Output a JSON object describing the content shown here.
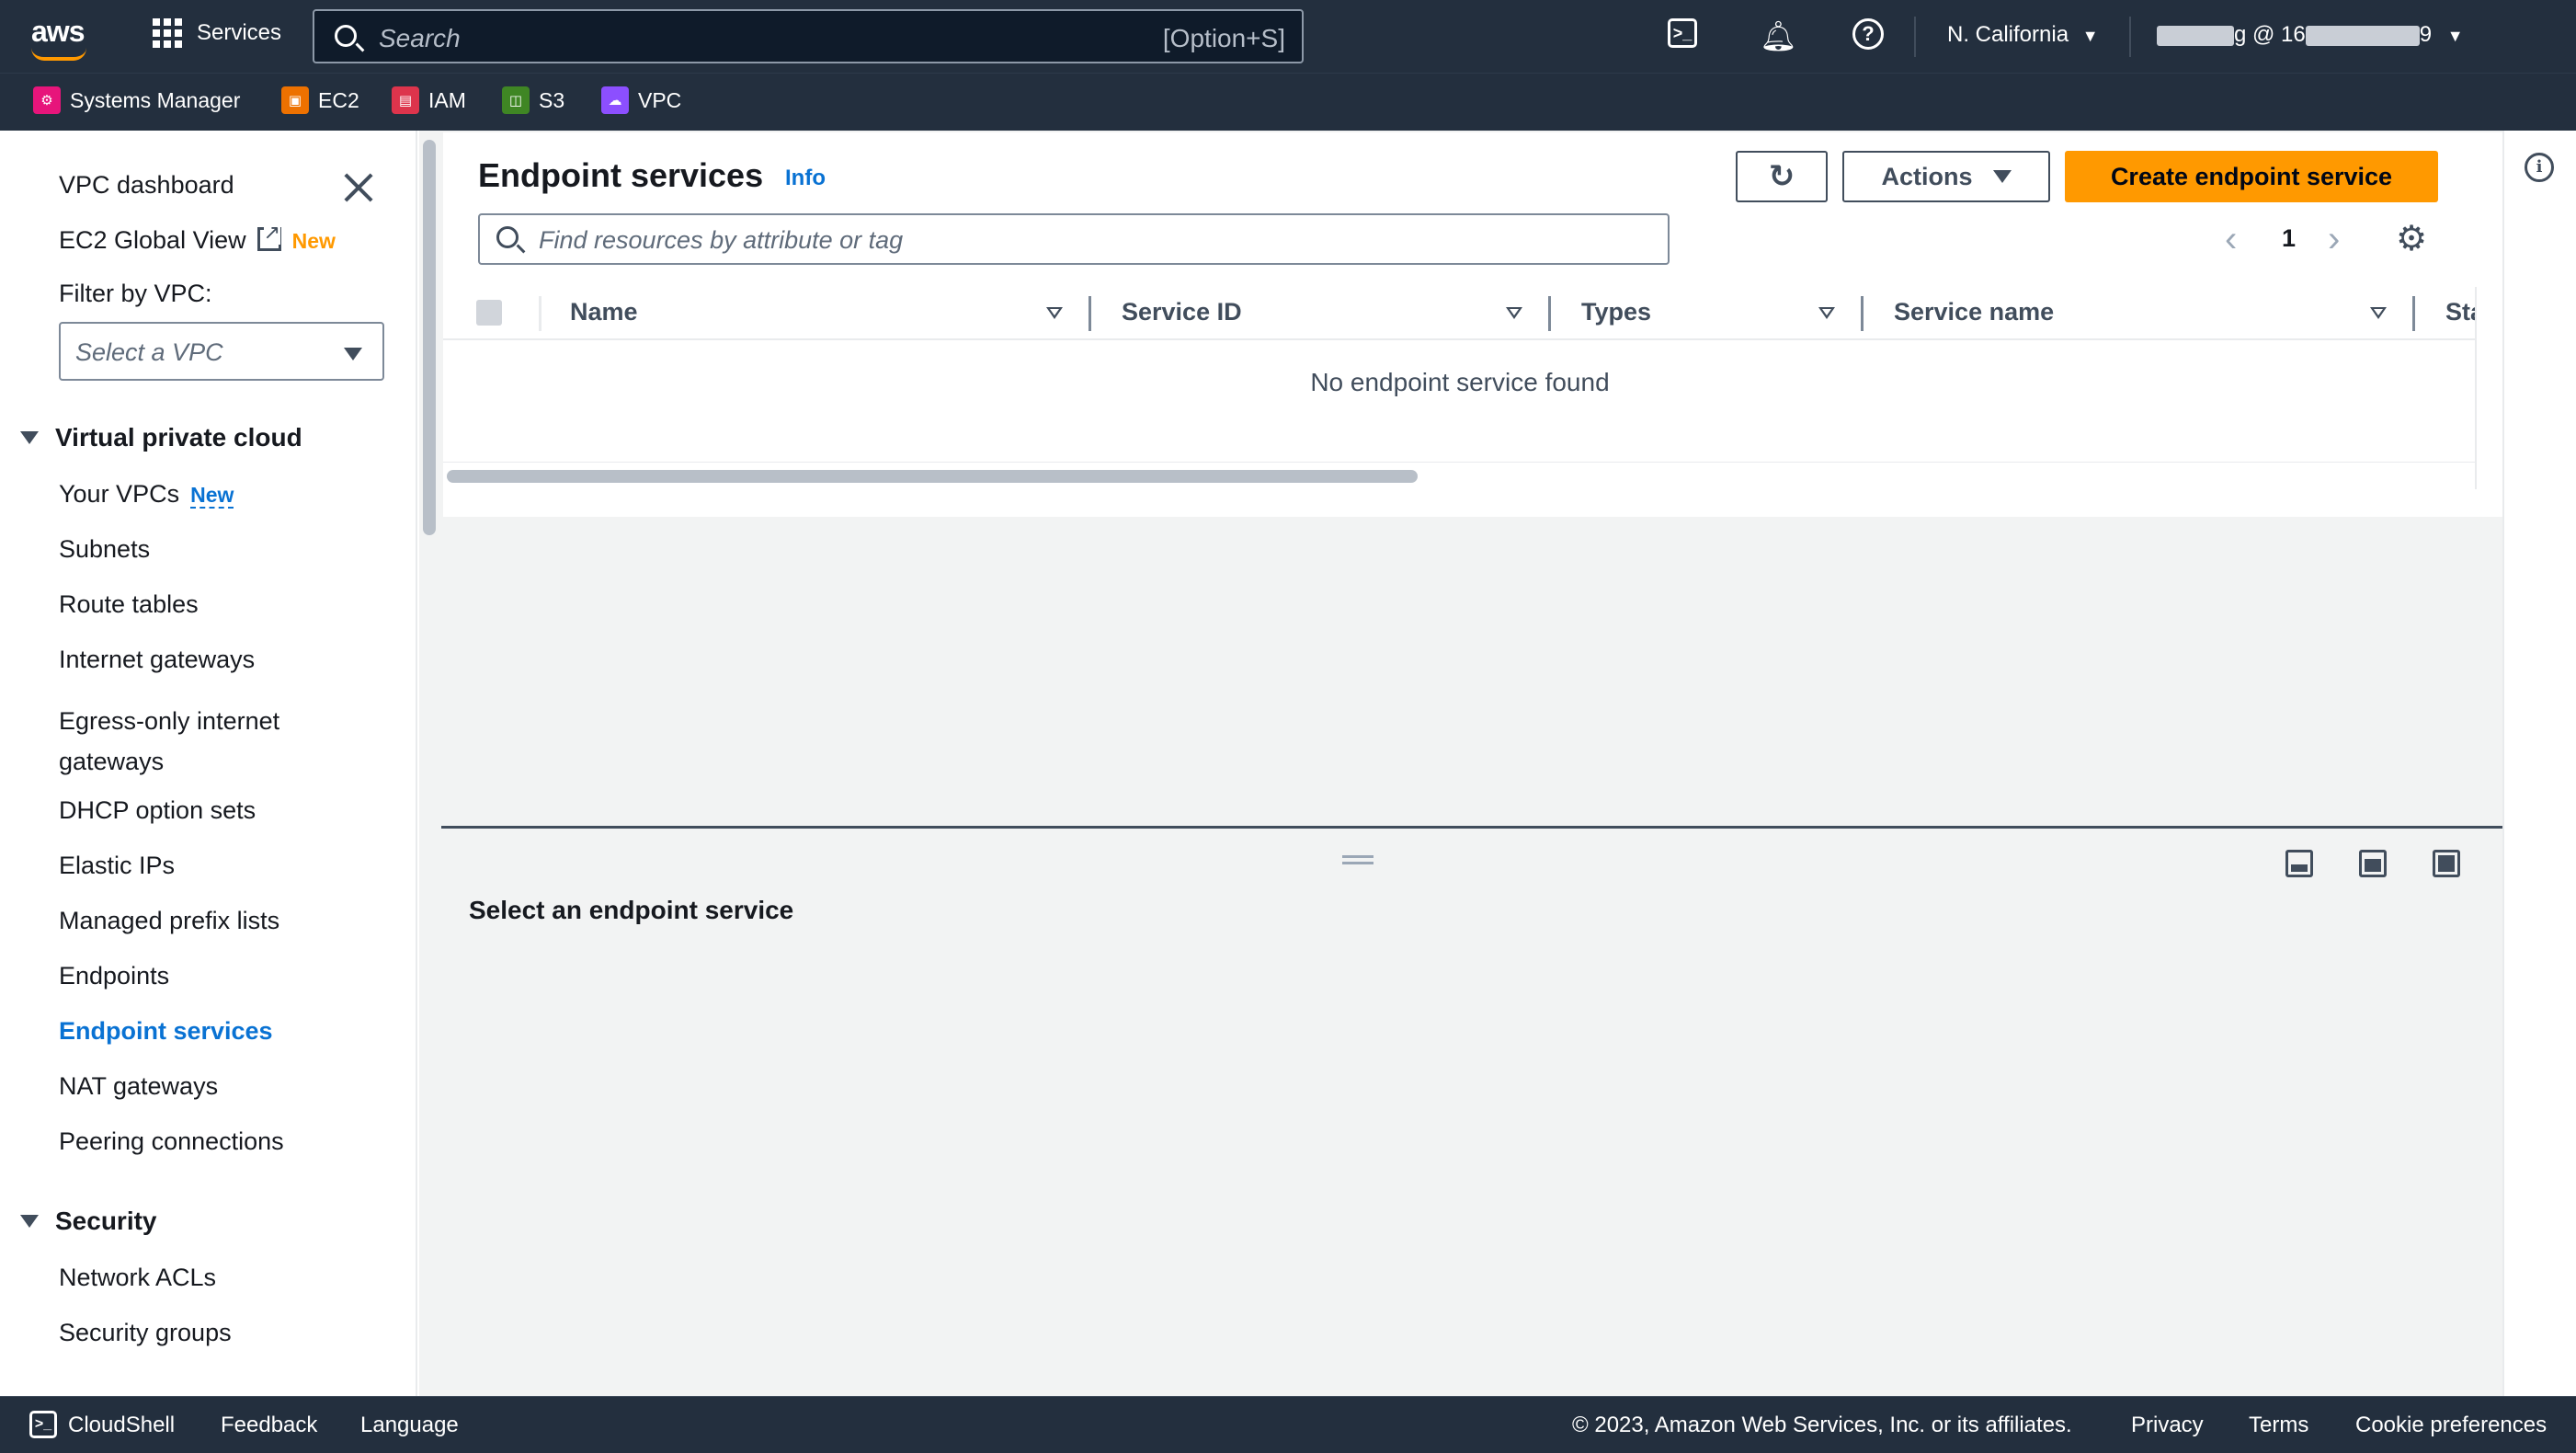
{
  "topnav": {
    "logo": "aws",
    "services_label": "Services",
    "search_placeholder": "Search",
    "search_shortcut": "[Option+S]",
    "region": "N. California",
    "account_prefix": "g @ 16",
    "account_suffix": "9"
  },
  "favorites": [
    {
      "label": "Systems Manager",
      "color": "#e7157b"
    },
    {
      "label": "EC2",
      "color": "#ed7100"
    },
    {
      "label": "IAM",
      "color": "#dd344c"
    },
    {
      "label": "S3",
      "color": "#3f8624"
    },
    {
      "label": "VPC",
      "color": "#8c4fff"
    }
  ],
  "sidebar": {
    "dashboard": "VPC dashboard",
    "global_view": "EC2 Global View",
    "global_view_badge": "New",
    "filter_label": "Filter by VPC:",
    "filter_placeholder": "Select a VPC",
    "sections": [
      {
        "title": "Virtual private cloud",
        "items": [
          "Your VPCs",
          "Subnets",
          "Route tables",
          "Internet gateways",
          "Egress-only internet gateways",
          "DHCP option sets",
          "Elastic IPs",
          "Managed prefix lists",
          "Endpoints",
          "Endpoint services",
          "NAT gateways",
          "Peering connections"
        ]
      },
      {
        "title": "Security",
        "items": [
          "Network ACLs",
          "Security groups"
        ]
      }
    ],
    "your_vpcs_badge": "New",
    "active_item": "Endpoint services"
  },
  "main": {
    "title": "Endpoint services",
    "info_label": "Info",
    "actions_label": "Actions",
    "create_label": "Create endpoint service",
    "filter_placeholder": "Find resources by attribute or tag",
    "page_number": "1",
    "columns": [
      "Name",
      "Service ID",
      "Types",
      "Service name",
      "Sta"
    ],
    "empty_message": "No endpoint service found",
    "split_panel_title": "Select an endpoint service"
  },
  "footer": {
    "cloudshell": "CloudShell",
    "feedback": "Feedback",
    "language": "Language",
    "copyright": "© 2023, Amazon Web Services, Inc. or its affiliates.",
    "privacy": "Privacy",
    "terms": "Terms",
    "cookies": "Cookie preferences"
  },
  "colors": {
    "nav_bg": "#232f3e",
    "accent": "#ff9900",
    "link": "#0972d3"
  }
}
